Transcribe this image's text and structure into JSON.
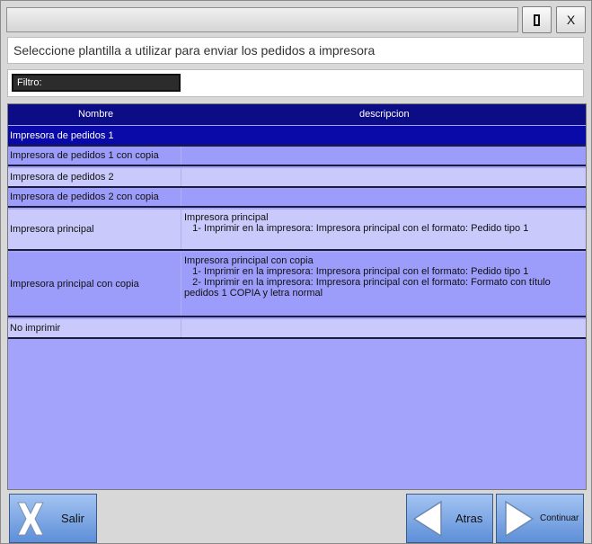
{
  "window": {
    "title": "",
    "max_label": "",
    "close_label": "X"
  },
  "prompt": "Seleccione plantilla a utilizar para enviar los pedidos a impresora",
  "filter": {
    "label": "Filtro:"
  },
  "table": {
    "columns": [
      "Nombre",
      "descripcion"
    ],
    "rows": [
      {
        "name": "Impresora de pedidos 1",
        "desc": ""
      },
      {
        "name": "Impresora de pedidos 1 con copia",
        "desc": ""
      },
      {
        "name": "Impresora de pedidos 2",
        "desc": ""
      },
      {
        "name": "Impresora de pedidos 2 con copia",
        "desc": ""
      },
      {
        "name": "Impresora principal",
        "desc": "Impresora principal\n   1- Imprimir en la impresora: Impresora principal con el formato: Pedido tipo 1"
      },
      {
        "name": "Impresora principal con copia",
        "desc": "Impresora principal con copia\n   1- Imprimir en la impresora: Impresora principal con el formato: Pedido tipo 1\n   2- Imprimir en la impresora: Impresora principal con el formato: Formato con título pedidos 1 COPIA y letra normal"
      },
      {
        "name": "No imprimir",
        "desc": ""
      }
    ],
    "selected_index": 0
  },
  "buttons": {
    "exit": "Salir",
    "back": "Atras",
    "next": "Continuar"
  },
  "colors": {
    "header": "#0c0c86",
    "selected_row": "#0a0aa8",
    "row_light": "#c9c9fb",
    "row_dark": "#9c9cfa",
    "grid_bg": "#a3a3fb"
  }
}
